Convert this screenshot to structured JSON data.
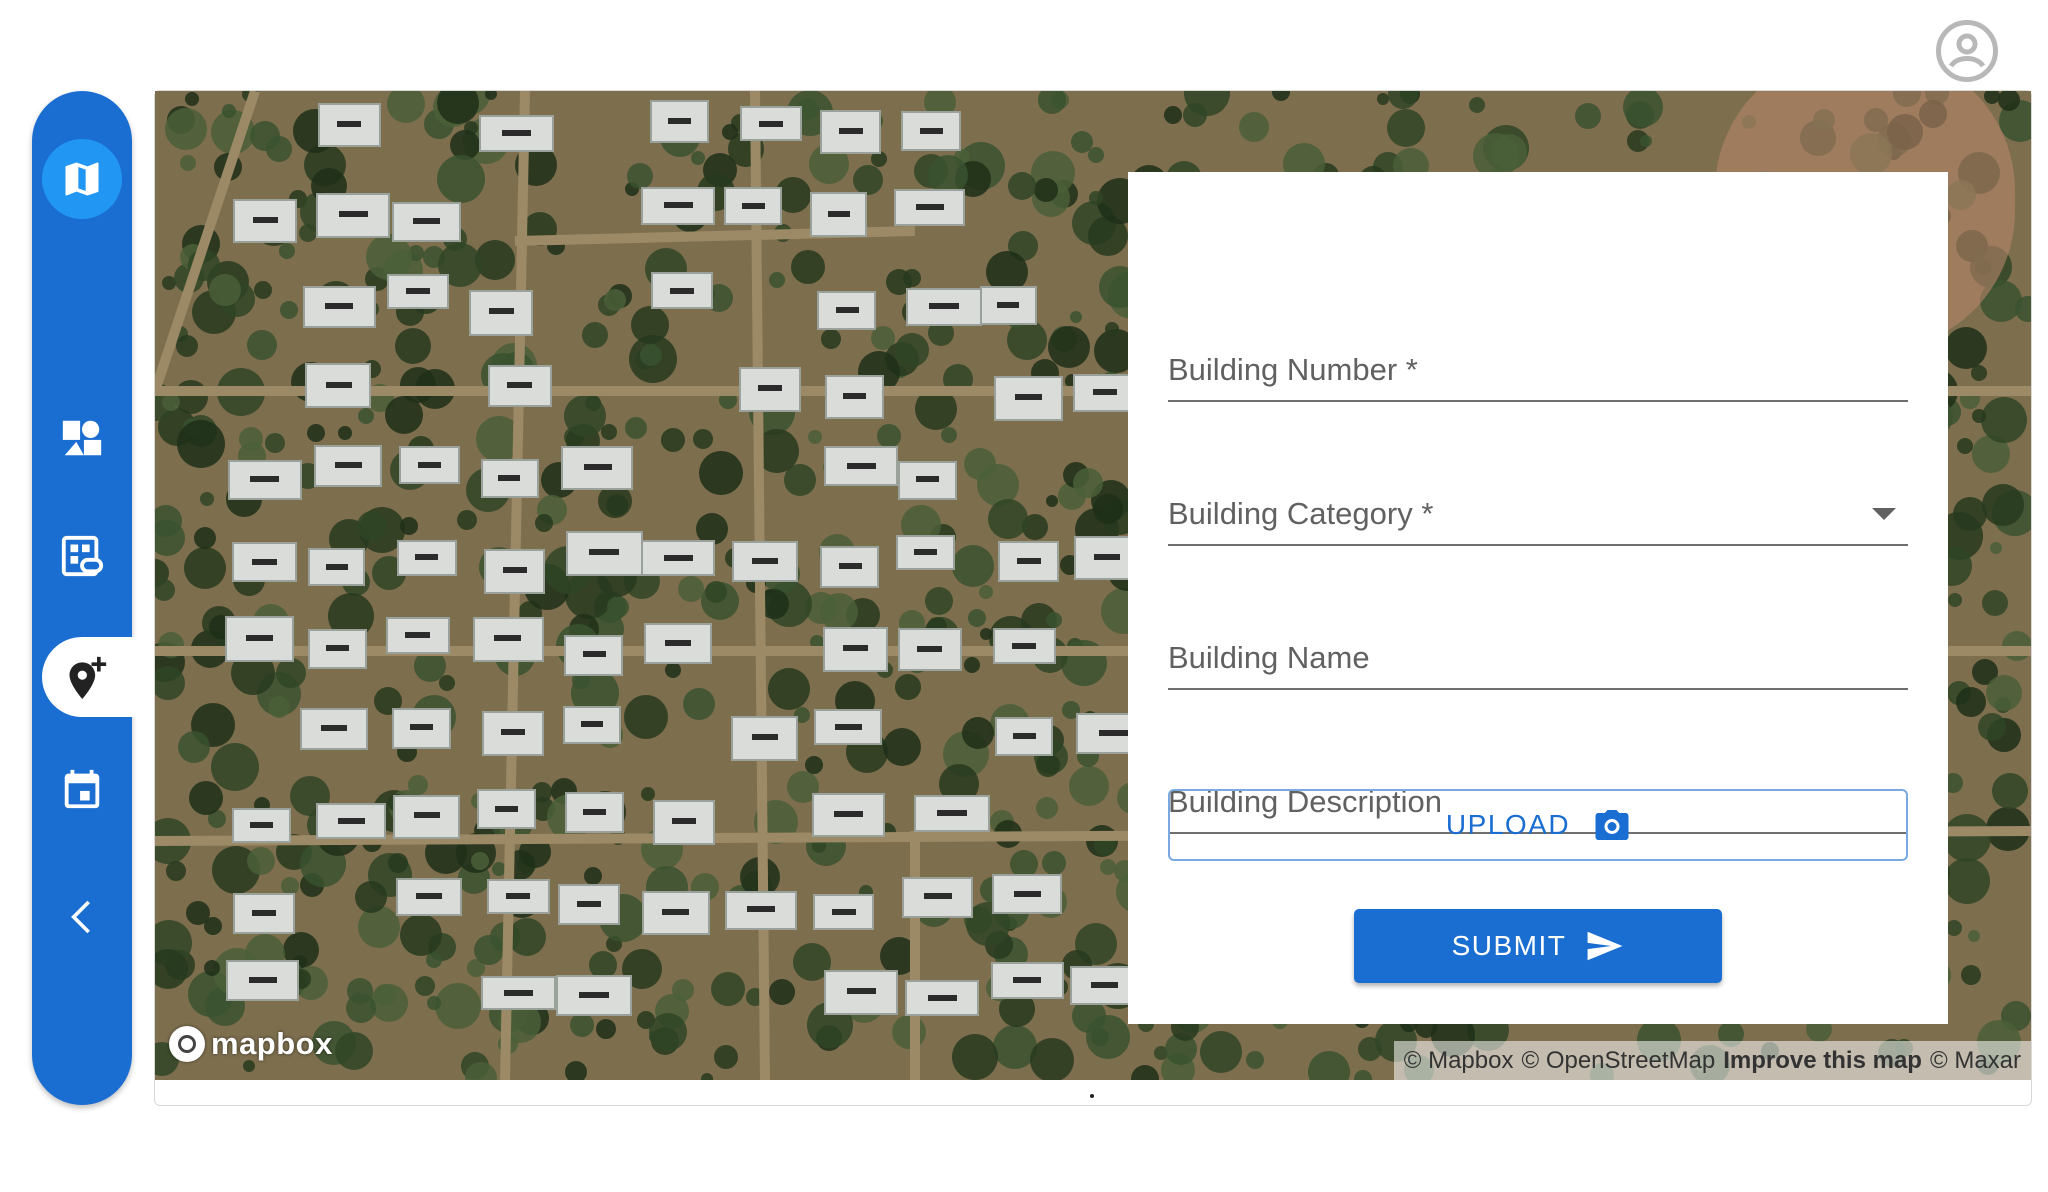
{
  "header": {
    "account_icon": "account-circle-icon"
  },
  "sidebar": {
    "items": [
      {
        "icon": "map-icon",
        "active_style": "circle"
      },
      {
        "icon": "shapes-icon"
      },
      {
        "icon": "linked-building-icon"
      },
      {
        "icon": "add-location-icon",
        "active": true
      },
      {
        "icon": "calendar-icon"
      },
      {
        "icon": "chevron-left-icon"
      }
    ],
    "color": "#1a6dd1"
  },
  "map": {
    "logo_text": "mapbox",
    "attribution": {
      "mapbox": "© Mapbox",
      "osm": "© OpenStreetMap",
      "improve": "Improve this map",
      "maxar": "© Maxar"
    }
  },
  "form": {
    "building_number_label": "Building Number *",
    "building_category_label": "Building Category *",
    "building_name_label": "Building Name",
    "building_description_label": "Building Description",
    "upload_label": "UPLOAD",
    "submit_label": "SUBMIT"
  },
  "colors": {
    "primary": "#1a6dd1",
    "accent": "#2196f3"
  }
}
